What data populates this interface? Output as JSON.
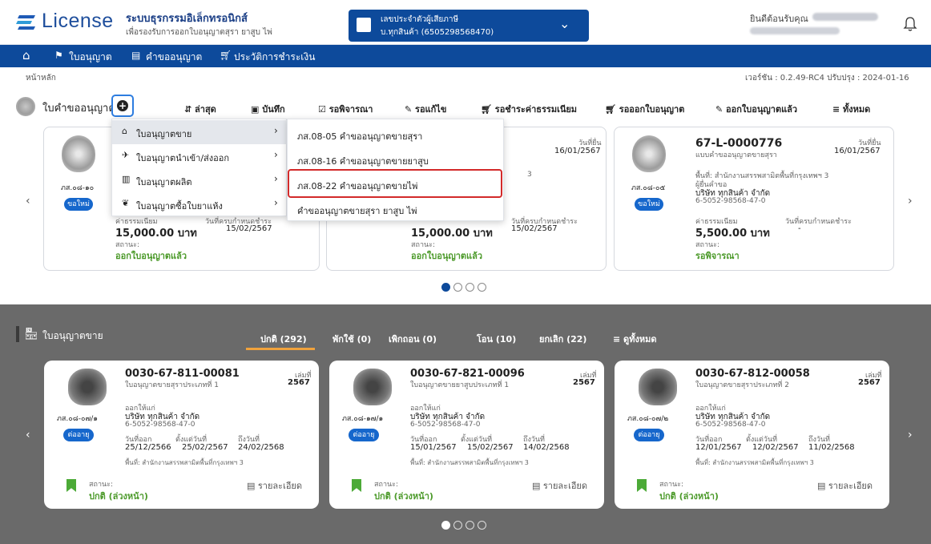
{
  "header": {
    "logo_text": "License",
    "system_title": "ระบบธุรกรรมอิเล็กทรอนิกส์",
    "system_subtitle": "เพื่อรองรับการออกใบอนุญาตสุรา ยาสูบ ไพ่",
    "company_line1": "เลขประจำตัวผู้เสียภาษี",
    "company_line2": "บ.ทุกสินค้า (6505298568470)",
    "welcome": "ยินดีต้อนรับคุณ"
  },
  "nav": {
    "items": [
      "ใบอนุญาต",
      "คำขออนุญาต",
      "ประวัติการชำระเงิน"
    ]
  },
  "breadcrumb": "หน้าหลัก",
  "version": "เวอร์ชัน : 0.2.49-RC4 ปรับปรุง : 2024-01-16",
  "requests": {
    "title": "ใบคำขออนุญาต",
    "filters": [
      "ล่าสุด",
      "บันทึก",
      "รอพิจารณา",
      "รอแก้ไข",
      "รอชำระค่าธรรมเนียม",
      "รอออกใบอนุญาต",
      "ออกใบอนุญาตแล้ว",
      "ทั้งหมด"
    ],
    "cards": [
      {
        "file_no": "ภส.๐๘-๑๐",
        "badge": "ขอใหม่",
        "fee_label": "ค่าธรรมเนียม",
        "fee": "15,000.00 บาท",
        "due_label": "วันที่ครบกำหนดชำระ",
        "due": "15/02/2567",
        "status_label": "สถานะ:",
        "status": "ออกใบอนุญาตแล้ว"
      },
      {
        "submitted_label": "วันที่ยื่น",
        "submitted": "16/01/2567",
        "area_fragment": "3",
        "due_label": "วันที่ครบกำหนดชำระ",
        "fee": "15,000.00 บาท",
        "due": "15/02/2567",
        "status_label": "สถานะ:",
        "status": "ออกใบอนุญาตแล้ว"
      },
      {
        "number": "67-L-0000776",
        "type": "แบบคำขออนุญาตขายสุรา",
        "submitted_label": "วันที่ยื่น",
        "submitted": "16/01/2567",
        "area": "พื้นที่: สำนักงานสรรพสามิตพื้นที่กรุงเทพฯ 3",
        "applicant_label": "ผู้ยื่นคำขอ",
        "company": "บริษัท ทุกสินค้า จำกัด",
        "tax_id": "6-5052-98568-47-0",
        "file_no": "ภส.๐๘-๐๕",
        "badge": "ขอใหม่",
        "fee_label": "ค่าธรรมเนียม",
        "fee": "5,500.00 บาท",
        "due_label": "วันที่ครบกำหนดชำระ",
        "due": "-",
        "status_label": "สถานะ:",
        "status": "รอพิจารณา"
      }
    ]
  },
  "menu_primary": [
    {
      "icon": "shop-icon",
      "label": "ใบอนุญาตขาย"
    },
    {
      "icon": "plane-icon",
      "label": "ใบอนุญาตนำเข้า/ส่งออก"
    },
    {
      "icon": "factory-icon",
      "label": "ใบอนุญาตผลิต"
    },
    {
      "icon": "leaf-icon",
      "label": "ใบอนุญาตซื้อใบยาแห้ง"
    }
  ],
  "menu_secondary": [
    "ภส.08-05 คำขออนุญาตขายสุรา",
    "ภส.08-16 คำขออนุญาตขายยาสูบ",
    "ภส.08-22 คำขออนุญาตขายไพ่",
    "คำขออนุญาตขายสุรา ยาสูบ ไพ่"
  ],
  "licenses": {
    "title": "ใบอนุญาตขาย",
    "tabs": [
      "ปกติ (292)",
      "พักใช้ (0)",
      "เพิกถอน (0)",
      "โอน (10)",
      "ยกเลิก (22)",
      "ดูทั้งหมด"
    ],
    "cards": [
      {
        "number": "0030-67-811-00081",
        "type": "ใบอนุญาตขายสุราประเภทที่ 1",
        "book_label": "เล่มที่",
        "book": "2567",
        "issued_to_label": "ออกให้แก่",
        "company": "บริษัท ทุกสินค้า จำกัด",
        "tax_id": "6-5052-98568-47-0",
        "file_no": "ภส.๐๘-๐๗/๑",
        "badge": "ต่ออายุ",
        "issue_label": "วันที่ออก",
        "issue": "25/12/2566",
        "from_label": "ตั้งแต่วันที่",
        "from": "25/02/2567",
        "to_label": "ถึงวันที่",
        "to": "24/02/2568",
        "area": "พื้นที่: สำนักงานสรรพสามิตพื้นที่กรุงเทพฯ 3",
        "status_label": "สถานะ:",
        "status": "ปกติ (ล่วงหน้า)",
        "details": "รายละเอียด"
      },
      {
        "number": "0030-67-821-00096",
        "type": "ใบอนุญาตขายยาสูบประเภทที่ 1",
        "book_label": "เล่มที่",
        "book": "2567",
        "issued_to_label": "ออกให้แก่",
        "company": "บริษัท ทุกสินค้า จำกัด",
        "tax_id": "6-5052-98568-47-0",
        "file_no": "ภส.๐๘-๑๗/๑",
        "badge": "ต่ออายุ",
        "issue_label": "วันที่ออก",
        "issue": "15/01/2567",
        "from_label": "ตั้งแต่วันที่",
        "from": "15/02/2567",
        "to_label": "ถึงวันที่",
        "to": "14/02/2568",
        "area": "พื้นที่: สำนักงานสรรพสามิตพื้นที่กรุงเทพฯ 3",
        "status_label": "สถานะ:",
        "status": "ปกติ (ล่วงหน้า)",
        "details": "รายละเอียด"
      },
      {
        "number": "0030-67-812-00058",
        "type": "ใบอนุญาตขายสุราประเภทที่ 2",
        "book_label": "เล่มที่",
        "book": "2567",
        "issued_to_label": "ออกให้แก่",
        "company": "บริษัท ทุกสินค้า จำกัด",
        "tax_id": "6-5052-98568-47-0",
        "file_no": "ภส.๐๘-๐๗/๒",
        "badge": "ต่ออายุ",
        "issue_label": "วันที่ออก",
        "issue": "12/01/2567",
        "from_label": "ตั้งแต่วันที่",
        "from": "12/02/2567",
        "to_label": "ถึงวันที่",
        "to": "11/02/2568",
        "area": "พื้นที่: สำนักงานสรรพสามิตพื้นที่กรุงเทพฯ 3",
        "status_label": "สถานะ:",
        "status": "ปกติ (ล่วงหน้า)",
        "details": "รายละเอียด"
      }
    ]
  },
  "colors": {
    "primary": "#0d4a9b",
    "accent_tab": "#f0a23c",
    "status_green": "#4c9a2a",
    "highlight": "#d32a2a"
  }
}
